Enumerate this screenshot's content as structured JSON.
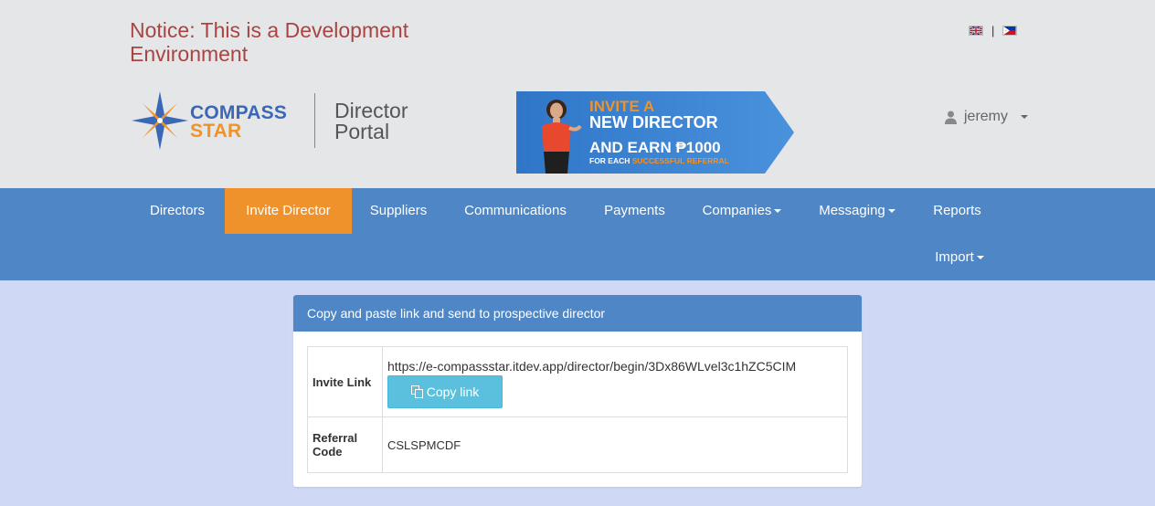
{
  "notice": "Notice: This is a Development Environment",
  "languages": [
    {
      "icon": "uk-flag-icon"
    },
    {
      "icon": "ph-flag-icon"
    }
  ],
  "logo": {
    "line1": "COMPASS",
    "line2": "STAR"
  },
  "portal": {
    "line1": "Director",
    "line2": "Portal"
  },
  "banner": {
    "line1": "INVITE A",
    "line2": "NEW DIRECTOR",
    "line3": "AND EARN ₱1000",
    "line4_prefix": "FOR EACH ",
    "line4_highlight": "SUCCESSFUL REFERRAL"
  },
  "user": {
    "name": "jeremy",
    "icon": "user-icon"
  },
  "nav": {
    "items": [
      {
        "label": "Directors"
      },
      {
        "label": "Invite Director",
        "active": true
      },
      {
        "label": "Suppliers"
      },
      {
        "label": "Communications"
      },
      {
        "label": "Payments"
      },
      {
        "label": "Companies",
        "dropdown": true
      },
      {
        "label": "Messaging",
        "dropdown": true
      },
      {
        "label": "Reports"
      },
      {
        "label": "Import",
        "dropdown": true
      }
    ]
  },
  "panel": {
    "heading": "Copy and paste link and send to prospective director",
    "invite_label": "Invite Link",
    "invite_url": "https://e-compassstar.itdev.app/director/begin/3Dx86WLvel3c1hZC5CIM",
    "copy_button": "Copy link",
    "referral_label_1": "Referral",
    "referral_label_2": "Code",
    "referral_code": "CSLSPMCDF"
  },
  "colors": {
    "nav_bg": "#4f86c6",
    "active_orange": "#f0922b",
    "notice_red": "#a94442",
    "copy_button": "#5bc0de",
    "content_bg": "#cfd8f5"
  }
}
